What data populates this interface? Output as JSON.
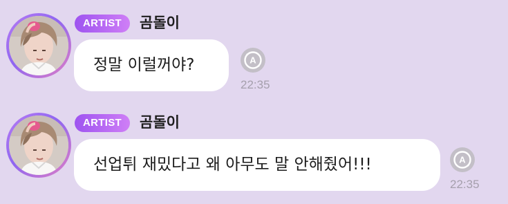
{
  "colors": {
    "background": "#e2d7ef",
    "badge_gradient_start": "#9e53f0",
    "badge_gradient_end": "#cf7ff6",
    "bubble": "#ffffff",
    "timestamp": "#a59fac",
    "translate_button": "#c3bfc7"
  },
  "messages": [
    {
      "badge": "ARTIST",
      "sender": "곰돌이",
      "text": "정말 이럴꺼야?",
      "time": "22:35",
      "translate_icon": "translate-icon",
      "avatar_icon": "avatar-photo"
    },
    {
      "badge": "ARTIST",
      "sender": "곰돌이",
      "text": "선업튀 재밌다고 왜 아무도 말 안해줬어!!!",
      "time": "22:35",
      "translate_icon": "translate-icon",
      "avatar_icon": "avatar-photo"
    }
  ]
}
